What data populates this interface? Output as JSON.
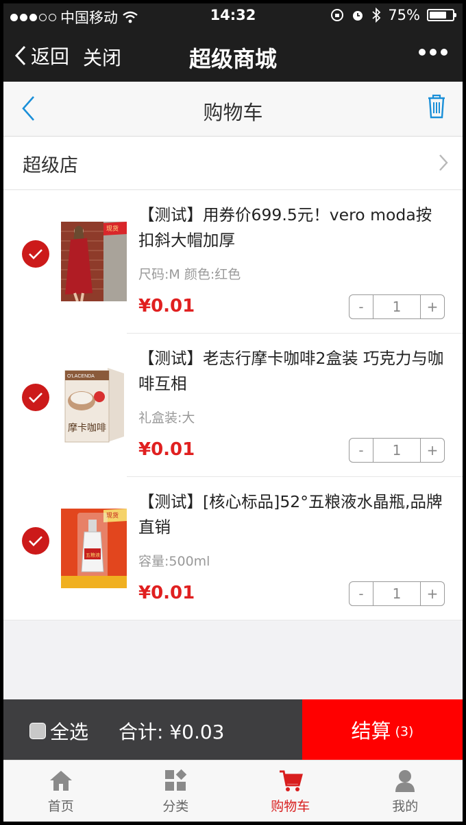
{
  "status_bar": {
    "carrier": "中国移动",
    "time": "14:32",
    "battery": "75%",
    "battery_level": 0.75
  },
  "nav": {
    "back_label": "返回",
    "close_label": "关闭",
    "title": "超级商城"
  },
  "page": {
    "title": "购物车"
  },
  "shop": {
    "name": "超级店"
  },
  "items": [
    {
      "name": "【测试】用券价699.5元！vero moda按扣斜大帽加厚",
      "spec": "尺码:M  颜色:红色",
      "price": "¥0.01",
      "qty": "1",
      "minus": "-",
      "plus": "+",
      "checked": true
    },
    {
      "name": "【测试】老志行摩卡咖啡2盒装 巧克力与咖啡互相",
      "spec": "礼盒装:大",
      "price": "¥0.01",
      "qty": "1",
      "minus": "-",
      "plus": "+",
      "checked": true
    },
    {
      "name": "【测试】[核心标品]52°五粮液水晶瓶,品牌直销",
      "spec": "容量:500ml",
      "price": "¥0.01",
      "qty": "1",
      "minus": "-",
      "plus": "+",
      "checked": true
    }
  ],
  "thumb_badges": {
    "first": "现货",
    "third": "现货"
  },
  "coffee_box": {
    "brand": "O'LACENDA",
    "label": "摩卡咖啡"
  },
  "bottle_label": "五粮液",
  "footer": {
    "select_all": "全选",
    "total": "合计: ¥0.03",
    "checkout_label": "结算",
    "checkout_count": "(3)"
  },
  "tabs": [
    {
      "label": "首页",
      "icon": "home-icon"
    },
    {
      "label": "分类",
      "icon": "category-icon"
    },
    {
      "label": "购物车",
      "icon": "cart-icon",
      "active": true
    },
    {
      "label": "我的",
      "icon": "user-icon"
    }
  ],
  "colors": {
    "accent": "#e02020",
    "checkout": "#ff0000",
    "nav_bg": "#1e1e1e",
    "link_blue": "#1a8fd8"
  }
}
